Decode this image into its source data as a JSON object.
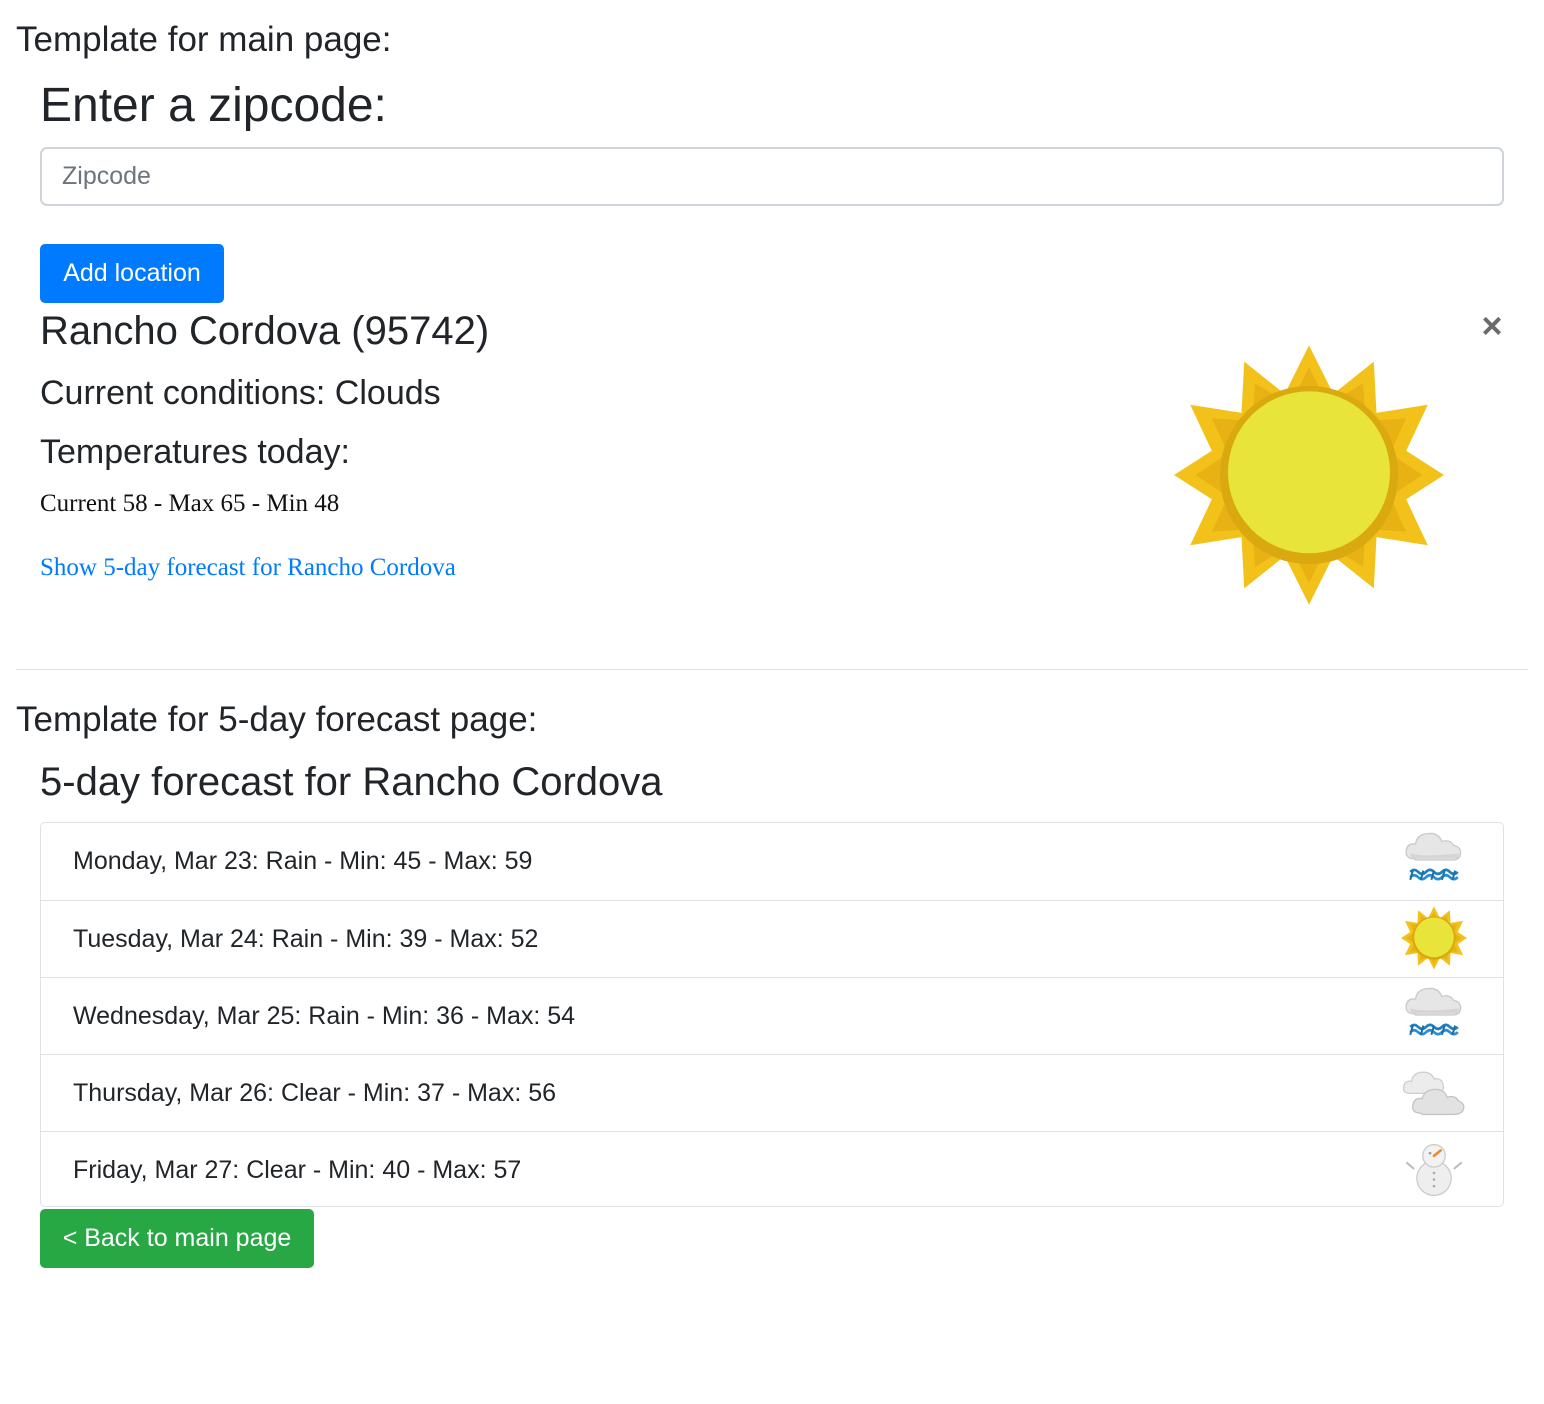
{
  "main_section": {
    "label": "Template for main page:",
    "heading": "Enter a zipcode:",
    "zip_input": {
      "placeholder": "Zipcode",
      "value": ""
    },
    "add_button": "Add location",
    "location": {
      "title": "Rancho Cordova (95742)",
      "close_symbol": "×",
      "conditions": "Current conditions: Clouds",
      "temps_heading": "Temperatures today:",
      "temps": "Current 58 - Max 65 - Min 48",
      "forecast_link": "Show 5-day forecast for Rancho Cordova",
      "icon": "sun-icon"
    }
  },
  "forecast_section": {
    "label": "Template for 5-day forecast page:",
    "heading": "5-day forecast for Rancho Cordova",
    "days": [
      {
        "text": "Monday, Mar 23: Rain - Min: 45 - Max: 59",
        "icon": "rain-cloud-icon"
      },
      {
        "text": "Tuesday, Mar 24: Rain - Min: 39 - Max: 52",
        "icon": "sun-icon"
      },
      {
        "text": "Wednesday, Mar 25: Rain - Min: 36 - Max: 54",
        "icon": "rain-cloud-icon"
      },
      {
        "text": "Thursday, Mar 26: Clear - Min: 37 - Max: 56",
        "icon": "clouds-icon"
      },
      {
        "text": "Friday, Mar 27: Clear - Min: 40 - Max: 57",
        "icon": "snowman-icon"
      }
    ],
    "back_button": "< Back to main page"
  },
  "colors": {
    "primary": "#007bff",
    "success": "#28a745",
    "text": "#212529",
    "border": "#dee2e6"
  }
}
